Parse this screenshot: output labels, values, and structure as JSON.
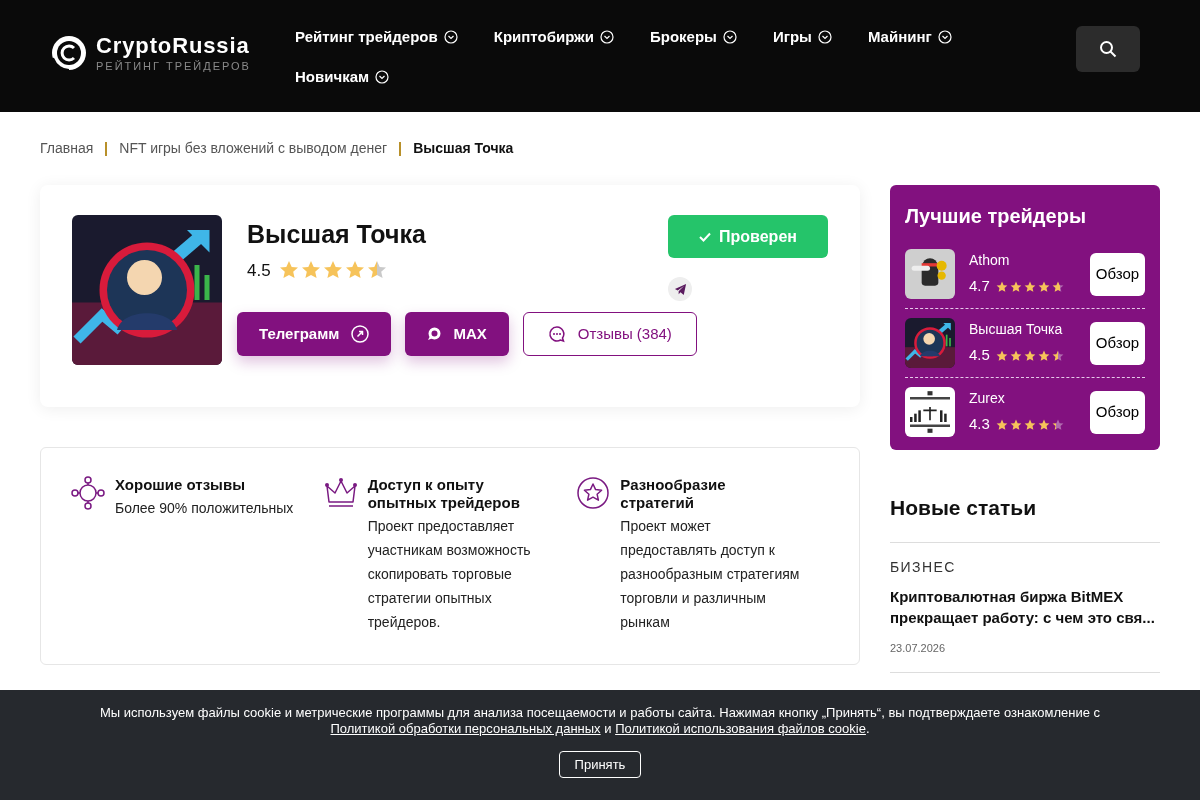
{
  "header": {
    "logo_title": "CryptoRussia",
    "logo_subtitle": "РЕЙТИНГ ТРЕЙДЕРОВ",
    "nav": [
      {
        "label": "Рейтинг трейдеров"
      },
      {
        "label": "Криптобиржи"
      },
      {
        "label": "Брокеры"
      },
      {
        "label": "Игры"
      },
      {
        "label": "Майнинг"
      },
      {
        "label": "Новичкам"
      }
    ]
  },
  "breadcrumbs": [
    {
      "label": "Главная",
      "current": false
    },
    {
      "label": "NFT игры без вложений с выводом денег",
      "current": false
    },
    {
      "label": "Высшая Точка",
      "current": true
    }
  ],
  "card": {
    "title": "Высшая Точка",
    "rating": "4.5",
    "stars": 4.5,
    "badge": "Проверен",
    "buttons": [
      {
        "kind": "telegram",
        "label": "Телеграмм"
      },
      {
        "kind": "max",
        "label": "MAX"
      },
      {
        "kind": "reviews",
        "label": "Отзывы (384)"
      }
    ]
  },
  "features": [
    {
      "kind": "network",
      "title": "Хорошие отзывы",
      "text": "Более 90% положительных"
    },
    {
      "kind": "crown",
      "title": "Доступ к опыту опытных трейдеров",
      "text": "Проект предоставляет участникам возможность скопировать торговые стратегии опытных трейдеров."
    },
    {
      "kind": "star",
      "title": "Разнообразие стратегий",
      "text": "Проект может предоставлять доступ к разнообразным стратегиям торговли и различным рынкам"
    }
  ],
  "top_traders": {
    "title": "Лучшие трейдеры",
    "items": [
      {
        "name": "Athom",
        "rating": "4.7",
        "stars": 4.7,
        "button": "Обзор"
      },
      {
        "name": "Высшая Точка",
        "rating": "4.5",
        "stars": 4.5,
        "button": "Обзор"
      },
      {
        "name": "Zurex",
        "rating": "4.3",
        "stars": 4.3,
        "button": "Обзор"
      }
    ]
  },
  "new_articles": {
    "title": "Новые статьи",
    "items": [
      {
        "category": "БИЗНЕС",
        "title": "Криптовалютная биржа BitMEX прекращает работу: с чем это свя...",
        "date": "23.07.2026"
      }
    ]
  },
  "cookie": {
    "text": "Мы используем файлы cookie и метрические программы для анализа посещаемости и работы сайта. Нажимая кнопку „Принять“, вы подтверждаете ознакомление с",
    "links": [
      "Политикой обработки персональных данных",
      "Политикой использования файлов cookie"
    ],
    "joiner": "и",
    "end": ".",
    "button": "Принять"
  }
}
